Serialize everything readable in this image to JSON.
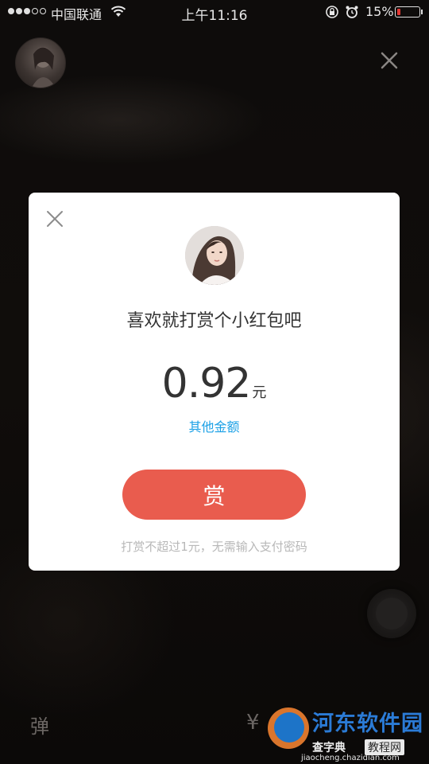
{
  "status_bar": {
    "carrier": "中国联通",
    "time": "上午11:16",
    "battery_percent": "15%",
    "battery_level": 0.15,
    "signal_strength": 3,
    "signal_max": 5
  },
  "live": {
    "danmu_label": "弹",
    "gift_icon_label": "¥"
  },
  "dialog": {
    "title": "喜欢就打赏个小红包吧",
    "amount": "0.92",
    "currency_unit": "元",
    "other_amount_link": "其他金额",
    "reward_button_label": "赏",
    "note": "打赏不超过1元，无需输入支付密码"
  },
  "watermark": {
    "title": "河东软件园",
    "sub_left": "查字典",
    "sub_right": "教程网",
    "url": "jiaocheng.chazidian.com"
  },
  "colors": {
    "accent_red": "#e95c4e",
    "link_blue": "#1aa0e6",
    "battery_red": "#e53935"
  }
}
